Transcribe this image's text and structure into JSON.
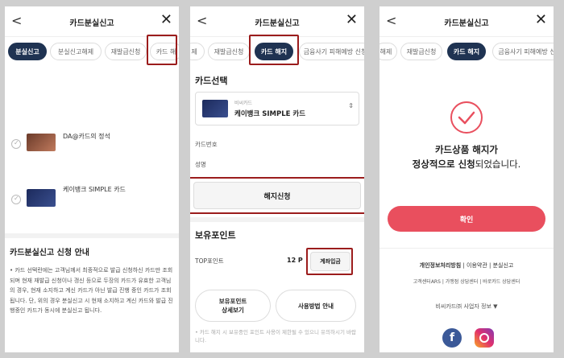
{
  "header": {
    "title": "카드분실신고",
    "back": "<",
    "close": "✕"
  },
  "p1": {
    "tabs": [
      "분실신고",
      "분실신고해제",
      "재발급신청",
      "카드 해"
    ],
    "cards": [
      "DA@카드의 정석",
      "케이뱅크 SIMPLE 카드"
    ],
    "guide_title": "카드분실신고 신청 안내",
    "guide_text": "• 카드 선택란에는 고객님께서 최종적으로 발급 신청하신 카드만 조회되며 현재 재발급 신청이나 갱신 등으로 두장의 카드가 유효한 고객님의 경우, 현재 소지하고 계신 카드가 아닌 발급 진행 중인 카드가 조회됩니다. 단, 위의 경우 분실신고 시 현재 소지하고 계신 카드와 발급 진행중인 카드가 동시에 분실신고 됩니다."
  },
  "p2": {
    "tabs": [
      "제",
      "재발급신청",
      "카드 해지",
      "금융사기 피해예방 신청"
    ],
    "select_title": "카드선택",
    "card_small": "비씨카드",
    "card_name": "케이뱅크 SIMPLE 카드",
    "card_number_label": "카드번호",
    "name_label": "성명",
    "cancel_button": "해지신청",
    "points_title": "보유포인트",
    "top_point_label": "TOP포인트",
    "top_point_value": "12 P",
    "account_deposit": "계좌입금",
    "view_points": "보유포인트\n상세보기",
    "usage_guide": "사용방법 안내",
    "note": "• 카드 해지 시 보유중인 포인트 사용이 제한될 수 있으니 유의하시기 바랍니다."
  },
  "p3": {
    "tabs": [
      "해제",
      "재발급신청",
      "카드 해지",
      "금융사기 피해예방 신"
    ],
    "msg_line1": "카드상품 해지가",
    "msg_line2_bold": "정상적으로 신청",
    "msg_line2_rest": "되었습니다.",
    "confirm": "확인",
    "footer_links1": [
      "개인정보처리방침",
      "이용약관",
      "분실신고"
    ],
    "footer_links2": [
      "고객센터ARS",
      "가맹점 상담센터",
      "바로카드 상담센터"
    ],
    "company_info": "비씨카드㈜ 사업자 정보",
    "accent": "#e94f5e"
  }
}
